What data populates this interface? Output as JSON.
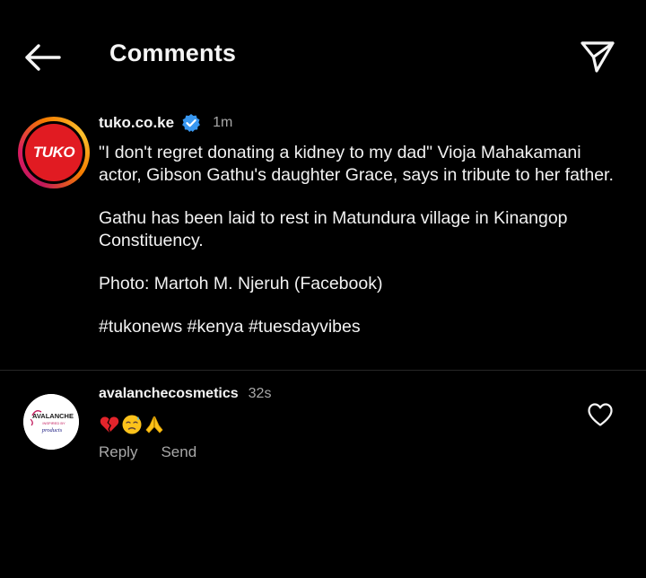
{
  "header": {
    "title": "Comments"
  },
  "icons": {
    "back": "arrow-left-icon",
    "share": "paper-plane-icon",
    "verified": "verified-badge-icon",
    "like": "heart-outline-icon"
  },
  "post": {
    "username": "tuko.co.ke",
    "time": "1m",
    "avatar_text": "TUKO",
    "avatar_color": "#e11b22",
    "caption": [
      "\"I don't regret donating a kidney to my dad\" Vioja Mahakamani actor, Gibson Gathu's daughter Grace, says in tribute to her father.",
      "Gathu has been laid to rest in Matundura village in Kinangop Constituency.",
      "Photo: Martoh M. Njeruh (Facebook)",
      "#tukonews #kenya #tuesdayvibes"
    ]
  },
  "comment": {
    "username": "avalanchecosmetics",
    "time": "32s",
    "avatar_text": "AVALANCHE",
    "avatar_subtext": "INSPIRED BY",
    "avatar_subtext2": "products",
    "emojis": [
      "broken-heart-emoji",
      "sad-relieved-face-emoji",
      "folded-hands-emoji"
    ],
    "reply_label": "Reply",
    "send_label": "Send"
  },
  "colors": {
    "background": "#000000",
    "text": "#f5f5f5",
    "secondary_text": "#a8a8a8",
    "verified_blue": "#3897f0",
    "divider": "#262626"
  }
}
